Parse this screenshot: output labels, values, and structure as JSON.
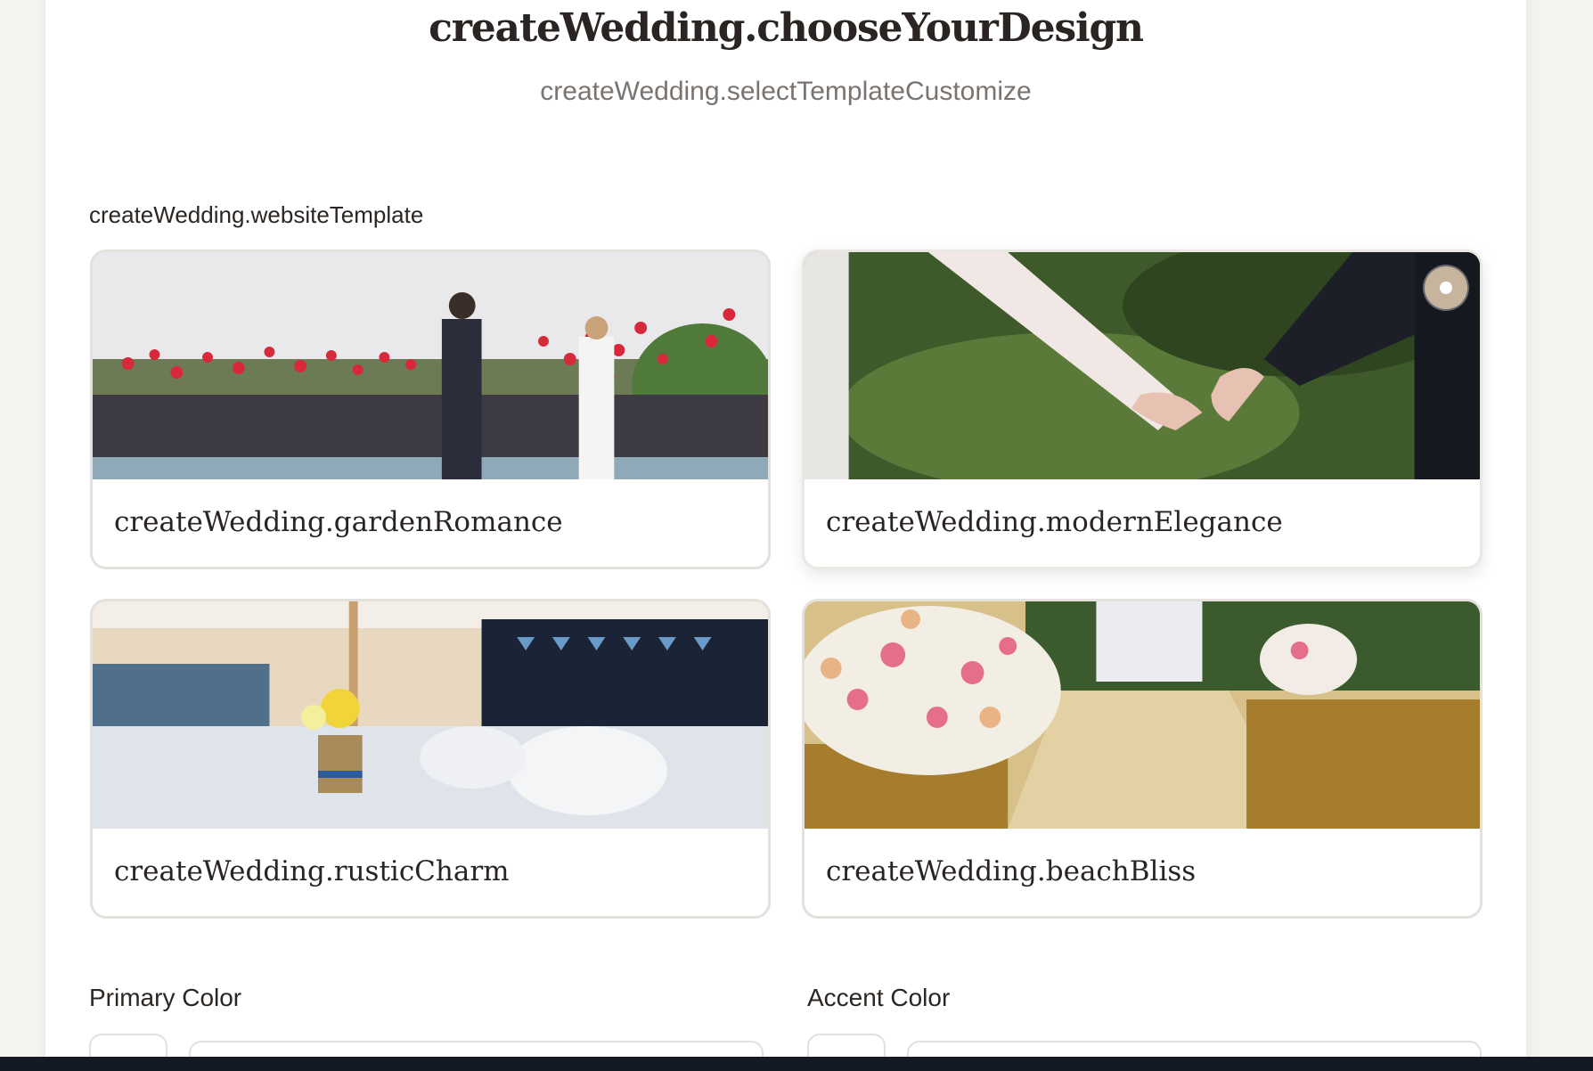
{
  "header": {
    "title": "createWedding.chooseYourDesign",
    "subtitle": "createWedding.selectTemplateCustomize"
  },
  "templates": {
    "section_label": "createWedding.websiteTemplate",
    "selected": "createWedding.modernElegance",
    "items": [
      {
        "name": "createWedding.gardenRomance",
        "image": "garden-party-balloons-photo"
      },
      {
        "name": "createWedding.modernElegance",
        "image": "holding-hands-photo"
      },
      {
        "name": "createWedding.rusticCharm",
        "image": "banquet-hall-tables-photo"
      },
      {
        "name": "createWedding.beachBliss",
        "image": "flower-aisle-chairs-photo"
      }
    ]
  },
  "colors": {
    "primary_label": "Primary Color",
    "accent_label": "Accent Color",
    "selected_radio_color": "#c6b59c"
  }
}
